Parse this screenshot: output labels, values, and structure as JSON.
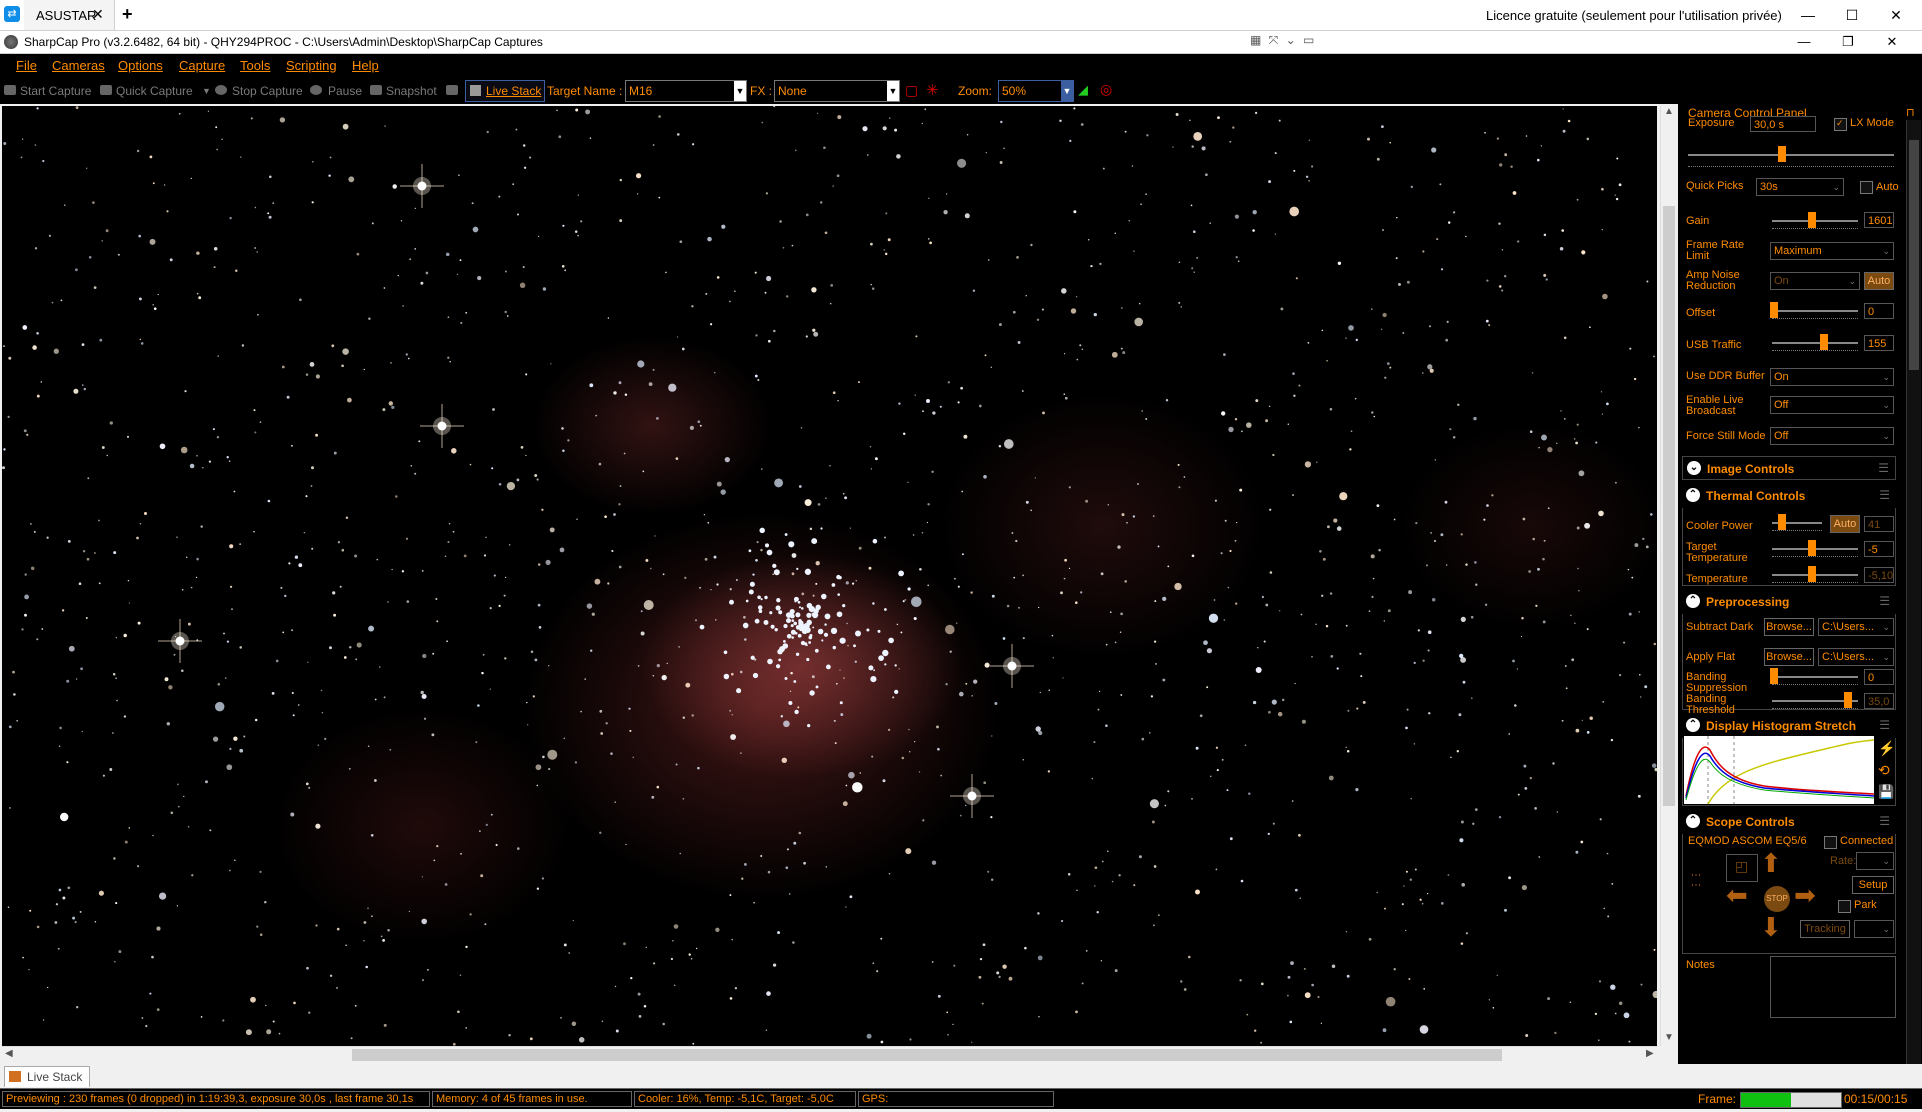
{
  "teamviewer": {
    "tab_label": "ASUSTAR",
    "tab_close": "✕",
    "new_tab": "+",
    "license_text": "Licence gratuite (seulement pour l'utilisation privée)",
    "minimize": "—",
    "maximize": "☐",
    "close": "✕"
  },
  "app": {
    "title": "SharpCap Pro (v3.2.6482, 64 bit) - QHY294PROC - C:\\Users\\Admin\\Desktop\\SharpCap Captures",
    "minimize": "—",
    "restore": "❐",
    "close": "✕"
  },
  "menu": [
    "File",
    "Cameras",
    "Options",
    "Capture",
    "Tools",
    "Scripting",
    "Help"
  ],
  "toolbar": {
    "start_capture": "Start Capture",
    "quick_capture": "Quick Capture",
    "stop_capture": "Stop Capture",
    "pause": "Pause",
    "snapshot": "Snapshot",
    "live_stack": "Live Stack",
    "target_name_label": "Target Name :",
    "target_name_value": "M16",
    "fx_label": "FX :",
    "fx_value": "None",
    "zoom_label": "Zoom:",
    "zoom_value": "50%"
  },
  "panel": {
    "title": "Camera Control Panel",
    "exposure_label": "Exposure",
    "exposure_value": "30,0 s",
    "lx_mode_label": "LX Mode",
    "lx_mode_checked": true,
    "quick_picks_label": "Quick Picks",
    "quick_picks_value": "30s",
    "auto_label": "Auto",
    "gain_label": "Gain",
    "gain_value": "1601",
    "frame_rate_label_1": "Frame Rate",
    "frame_rate_label_2": "Limit",
    "frame_rate_value": "Maximum",
    "amp_noise_label_1": "Amp Noise",
    "amp_noise_label_2": "Reduction",
    "amp_noise_value": "On",
    "amp_auto": "Auto",
    "offset_label": "Offset",
    "offset_value": "0",
    "usb_label": "USB Traffic",
    "usb_value": "155",
    "ddr_label": "Use DDR Buffer",
    "ddr_value": "On",
    "live_broadcast_label_1": "Enable Live",
    "live_broadcast_label_2": "Broadcast",
    "live_broadcast_value": "Off",
    "force_still_label": "Force Still Mode",
    "force_still_value": "Off",
    "image_controls": "Image Controls",
    "thermal_controls": "Thermal Controls",
    "cooler_power_label": "Cooler Power",
    "cooler_auto": "Auto",
    "cooler_power_value": "41",
    "target_temp_label_1": "Target",
    "target_temp_label_2": "Temperature",
    "target_temp_value": "-5",
    "temperature_label": "Temperature",
    "temperature_value": "-5,10",
    "preprocessing": "Preprocessing",
    "subtract_dark_label": "Subtract Dark",
    "browse": "Browse...",
    "dark_path": "C:\\Users...",
    "apply_flat_label": "Apply Flat",
    "flat_path": "C:\\Users...",
    "banding_supp_label_1": "Banding",
    "banding_supp_label_2": "Suppression",
    "banding_supp_value": "0",
    "banding_thresh_label_1": "Banding",
    "banding_thresh_label_2": "Threshold",
    "banding_thresh_value": "35,0",
    "display_histogram": "Display Histogram Stretch",
    "scope_controls": "Scope Controls",
    "scope_name": "EQMOD ASCOM EQ5/6",
    "connected_label": "Connected",
    "rate_label": "Rate:",
    "setup": "Setup",
    "park": "Park",
    "stop": "STOP",
    "tracking": "Tracking",
    "notes_label": "Notes"
  },
  "bottom_tab": "Live Stack",
  "status": {
    "previewing": "Previewing : 230 frames (0 dropped) in 1:19:39,3, exposure 30,0s , last frame 30,1s",
    "memory": "Memory: 4 of 45 frames in use.",
    "cooler": "Cooler: 16%, Temp: -5,1C, Target: -5,0C",
    "gps": "GPS:",
    "frame_label": "Frame:",
    "frame_progress": 0.5,
    "frame_time": "00:15/00:15"
  },
  "colors": {
    "accent_orange": "#ff8c00",
    "nebula_red": "#a04646",
    "progress_green": "#10c010"
  }
}
